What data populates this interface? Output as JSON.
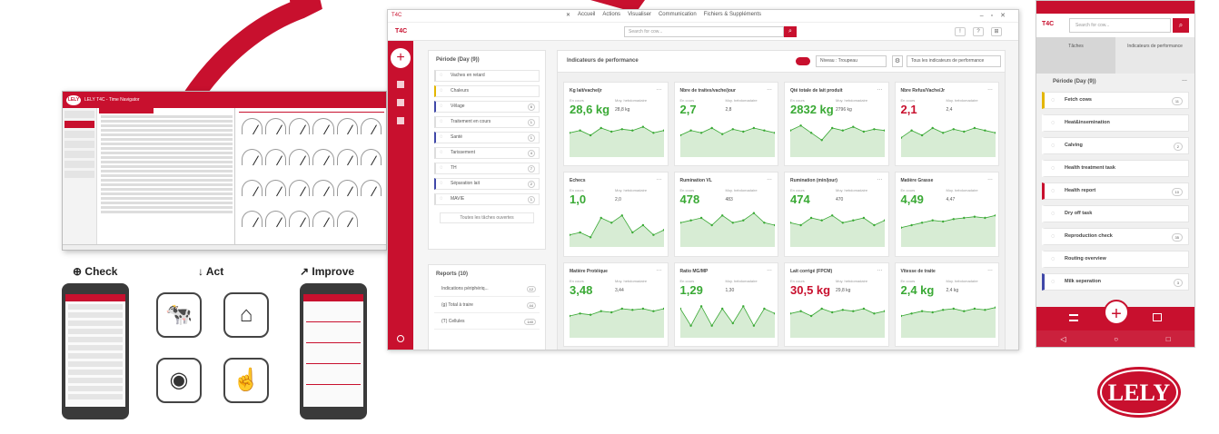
{
  "old_app": {
    "window_title": "LELY T4C - Time Navigator",
    "logo": "LELY"
  },
  "steps": {
    "check": "Check",
    "act": "Act",
    "improve": "Improve"
  },
  "main": {
    "titlebar": {
      "app": "T4C",
      "menus": [
        "Accueil",
        "Actions",
        "Visualiser",
        "Communication",
        "Fichiers & Suppléments"
      ]
    },
    "brand": "T4C",
    "search_placeholder": "Search for cow...",
    "header_icons": [
      "?",
      "!",
      "⊞"
    ],
    "tasks": {
      "title": "Période (Day (9))",
      "items": [
        {
          "label": "Vaches en retard",
          "count": "",
          "color": "",
          "icon": "cow-icon"
        },
        {
          "label": "Chaleurs",
          "count": "",
          "color": "yellow",
          "icon": "heat-icon"
        },
        {
          "label": "Vêlage",
          "count": "6",
          "color": "blue",
          "icon": "calving-icon"
        },
        {
          "label": "Traitement en cours",
          "count": "1",
          "color": "",
          "icon": "treatment-icon"
        },
        {
          "label": "Santé",
          "count": "1",
          "color": "blue",
          "icon": "health-icon"
        },
        {
          "label": "Tarissement",
          "count": "4",
          "color": "",
          "icon": "dry-off-icon"
        },
        {
          "label": "TH",
          "count": "7",
          "color": "",
          "icon": "th-icon"
        },
        {
          "label": "Séparation lait",
          "count": "2",
          "color": "blue",
          "icon": "milk-separation-icon"
        },
        {
          "label": "MAVIE",
          "count": "1",
          "color": "",
          "icon": "mavie-icon"
        }
      ],
      "all_button": "Toutes les tâches ouvertes"
    },
    "reports": {
      "title": "Reports (10)",
      "items": [
        {
          "label": "Indications périphériq...",
          "count": "12"
        },
        {
          "label": "(g) Total à traire",
          "count": "44"
        },
        {
          "label": "(T) Cellules",
          "count": "140"
        }
      ]
    },
    "kpi": {
      "title": "Indicateurs de performance",
      "niveau": "Niveau : Troupeau",
      "all_button": "Tous les indicateurs de performance",
      "cards": [
        {
          "title": "Kg lait/vache/jr",
          "sub1": "En cours",
          "sub2": "Moy. hebdomadaire",
          "value": "28,6 kg",
          "avg": "28,8 kg",
          "red": false,
          "points": [
            20,
            22,
            18,
            24,
            21,
            23,
            22,
            25,
            20,
            22
          ]
        },
        {
          "title": "Nbre de traites/vache/jour",
          "sub1": "En cours",
          "sub2": "Moy. hebdomadaire",
          "value": "2,7",
          "avg": "2,8",
          "red": false,
          "points": [
            18,
            22,
            20,
            24,
            19,
            23,
            21,
            24,
            22,
            20
          ]
        },
        {
          "title": "Qté totale de lait produit",
          "sub1": "En cours",
          "sub2": "Moy. hebdomadaire",
          "value": "2832 kg",
          "avg": "2796 kg",
          "red": false,
          "points": [
            22,
            26,
            20,
            14,
            24,
            22,
            25,
            21,
            23,
            22
          ]
        },
        {
          "title": "Nbre Refus/Vache/Jr",
          "sub1": "En cours",
          "sub2": "Moy. hebdomadaire",
          "value": "2,1",
          "avg": "2,4",
          "red": true,
          "points": [
            16,
            22,
            18,
            24,
            20,
            23,
            21,
            24,
            22,
            20
          ]
        },
        {
          "title": "Echecs",
          "sub1": "En cours",
          "sub2": "Moy. hebdomadaire",
          "value": "1,0",
          "avg": "2,0",
          "red": false,
          "points": [
            10,
            12,
            8,
            24,
            20,
            26,
            12,
            18,
            10,
            14
          ]
        },
        {
          "title": "Rumination VL",
          "sub1": "En cours",
          "sub2": "Moy. hebdomadaire",
          "value": "478",
          "avg": "483",
          "red": false,
          "points": [
            20,
            22,
            24,
            18,
            26,
            20,
            22,
            28,
            20,
            18
          ]
        },
        {
          "title": "Rumination (min/jour)",
          "sub1": "En cours",
          "sub2": "Moy. hebdomadaire",
          "value": "474",
          "avg": "470",
          "red": false,
          "points": [
            20,
            18,
            24,
            22,
            26,
            20,
            22,
            24,
            18,
            22
          ]
        },
        {
          "title": "Matière Grasse",
          "sub1": "En cours",
          "sub2": "Moy. hebdomadaire",
          "value": "4,49",
          "avg": "4,47",
          "red": false,
          "points": [
            16,
            18,
            20,
            22,
            21,
            23,
            24,
            25,
            24,
            26
          ]
        },
        {
          "title": "Matière Protéique",
          "sub1": "En cours",
          "sub2": "Moy. hebdomadaire",
          "value": "3,48",
          "avg": "3,44",
          "red": false,
          "points": [
            18,
            20,
            19,
            22,
            21,
            24,
            23,
            24,
            22,
            24
          ]
        },
        {
          "title": "Ratio MG/MP",
          "sub1": "En cours",
          "sub2": "Moy. hebdomadaire",
          "value": "1,29",
          "avg": "1,30",
          "red": false,
          "points": [
            24,
            10,
            26,
            10,
            24,
            12,
            26,
            10,
            24,
            20
          ]
        },
        {
          "title": "Lait corrigé (FPCM)",
          "sub1": "En cours",
          "sub2": "Moy. hebdomadaire",
          "value": "30,5 kg",
          "avg": "29,8 kg",
          "red": true,
          "points": [
            20,
            22,
            18,
            24,
            21,
            23,
            22,
            24,
            20,
            22
          ]
        },
        {
          "title": "Vitesse de traite",
          "sub1": "En cours",
          "sub2": "Moy. hebdomadaire",
          "value": "2,4 kg",
          "avg": "2,4 kg",
          "red": false,
          "points": [
            18,
            20,
            22,
            21,
            23,
            24,
            22,
            24,
            23,
            25
          ]
        }
      ]
    }
  },
  "mobile": {
    "brand": "T4C",
    "search_placeholder": "Search for cow...",
    "tabs": [
      "Tâches",
      "Indicateurs de performance"
    ],
    "period": "Période (Day (9))",
    "items": [
      {
        "label": "Fetch cows",
        "count": "11",
        "color": "y",
        "icon": "cow-icon"
      },
      {
        "label": "Heat&insemination",
        "count": "",
        "color": "",
        "icon": "heat-icon"
      },
      {
        "label": "Calving",
        "count": "2",
        "color": "",
        "icon": "calving-icon"
      },
      {
        "label": "Health treatment task",
        "count": "",
        "color": "",
        "icon": "treatment-icon"
      },
      {
        "label": "Health report",
        "count": "10",
        "color": "r",
        "icon": "health-icon"
      },
      {
        "label": "Dry off task",
        "count": "",
        "color": "",
        "icon": "dry-off-icon"
      },
      {
        "label": "Reproduction check",
        "count": "35",
        "color": "",
        "icon": "reproduction-icon"
      },
      {
        "label": "Routing overview",
        "count": "",
        "color": "",
        "icon": "routing-icon"
      },
      {
        "label": "Milk seperation",
        "count": "3",
        "color": "b",
        "icon": "milk-separation-icon"
      }
    ]
  },
  "brand_logo": "LELY",
  "colors": {
    "accent": "#c8102e",
    "good": "#3aa935",
    "chart_fill": "#d7ecd4"
  }
}
